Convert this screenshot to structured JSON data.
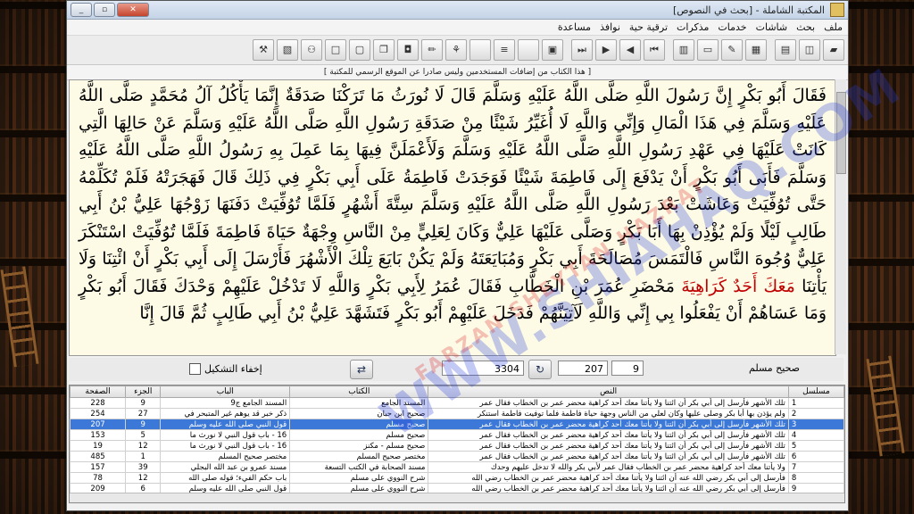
{
  "window": {
    "title": "المكتبة الشاملة - [بحث في النصوص]",
    "controls": [
      "_",
      "▫",
      "✕"
    ]
  },
  "menu": [
    "ملف",
    "بحث",
    "شاشات",
    "خدمات",
    "مذكرات",
    "ترقية حية",
    "نوافذ",
    "مساعدة"
  ],
  "toolbar_icons": [
    "book-icon",
    "open-book-icon",
    "layout-icon",
    "grid-icon",
    "edit-icon",
    "folder-icon",
    "print-icon",
    "first-icon",
    "prev-icon",
    "next-icon",
    "last-icon",
    "library-icon",
    "blank1",
    "blank2",
    "blank3",
    "edit2-icon",
    "pen-icon",
    "note-icon",
    "copy-icon",
    "save-icon",
    "doc-icon",
    "binoculars-icon",
    "calendar-icon",
    "tools-icon"
  ],
  "notice": "[ هذا الكتاب من إضافات المستخدمين وليس صادرا عن الموقع الرسمي للمكتبة ]",
  "text": {
    "before_highlight": "فَقَالَ أَبُو بَكْرٍ إِنَّ رَسُولَ اللَّهِ صَلَّى اللَّهُ عَلَيْهِ وَسَلَّمَ قَالَ لَا نُورَثُ مَا تَرَكْنَا صَدَقَةٌ إِنَّمَا يَأْكُلُ آلُ مُحَمَّدٍ صَلَّى اللَّهُ عَلَيْهِ وَسَلَّمَ فِي هَذَا الْمَالِ وَإِنِّي وَاللَّهِ لَا أُغَيِّرُ شَيْئًا مِنْ صَدَقَةِ رَسُولِ اللَّهِ صَلَّى اللَّهُ عَلَيْهِ وَسَلَّمَ عَنْ حَالِهَا الَّتِي كَانَتْ عَلَيْهَا فِي عَهْدِ رَسُولِ اللَّهِ صَلَّى اللَّهُ عَلَيْهِ وَسَلَّمَ وَلَأَعْمَلَنَّ فِيهَا بِمَا عَمِلَ بِهِ رَسُولُ اللَّهِ صَلَّى اللَّهُ عَلَيْهِ وَسَلَّمَ فَأَبَى أَبُو بَكْرٍ أَنْ يَدْفَعَ إِلَى فَاطِمَةَ شَيْئًا فَوَجَدَتْ فَاطِمَةُ عَلَى أَبِي بَكْرٍ فِي ذَلِكَ قَالَ فَهَجَرَتْهُ فَلَمْ تُكَلِّمْهُ حَتَّى تُوُفِّيَتْ وَعَاشَتْ بَعْدَ رَسُولِ اللَّهِ صَلَّى اللَّهُ عَلَيْهِ وَسَلَّمَ سِتَّةَ أَشْهُرٍ فَلَمَّا تُوُفِّيَتْ دَفَنَهَا زَوْجُهَا عَلِيُّ بْنُ أَبِي طَالِبٍ لَيْلًا وَلَمْ يُؤْذِنْ بِهَا أَبَا بَكْرٍ وَصَلَّى عَلَيْهَا عَلِيٌّ وَكَانَ لِعَلِيٍّ مِنْ النَّاسِ وِجْهَةٌ حَيَاةَ فَاطِمَةَ فَلَمَّا تُوُفِّيَتْ اسْتَنْكَرَ عَلِيٌّ وُجُوهَ النَّاسِ فَالْتَمَسَ مُصَالَحَةَ أَبِي بَكْرٍ وَمُبَايَعَتَهُ وَلَمْ يَكُنْ بَايَعَ تِلْكَ الْأَشْهُرَ فَأَرْسَلَ إِلَى أَبِي بَكْرٍ أَنْ ائْتِنَا وَلَا يَأْتِنَا",
    "highlight": "مَعَكَ أَحَدٌ كَرَاهِيَةَ",
    "after_highlight": "مَحْضَرِ عُمَرَ بْنِ الْخَطَّابِ فَقَالَ عُمَرُ لِأَبِي بَكْرٍ وَاللَّهِ لَا تَدْخُلْ عَلَيْهِمْ وَحْدَكَ فَقَالَ أَبُو بَكْرٍ وَمَا عَسَاهُمْ أَنْ يَفْعَلُوا بِي إِنِّي وَاللَّهِ لَآتِيَنَّهُمْ فَدَخَلَ عَلَيْهِمْ أَبُو بَكْرٍ فَتَشَهَّدَ عَلِيُّ بْنُ أَبِي طَالِبٍ ثُمَّ قَالَ إِنَّا"
  },
  "watermark": {
    "main": "WWW.SHIAHAQ.COM",
    "sub": "FARZAN SHEYTAN HAZRAT"
  },
  "nav": {
    "hide_diacritics_label": "إخفاء التشكيل",
    "field_a": "3304",
    "field_b": "207",
    "field_c": "9",
    "book_label": "صحيح مسلم"
  },
  "table": {
    "headers": [
      "الصفحة",
      "الجزء",
      "الباب",
      "الكتاب",
      "النص",
      "مسلسل"
    ],
    "rows": [
      {
        "page": "228",
        "part": "9",
        "chapter": "المسند الجامع ج9",
        "book": "المسند الجامع",
        "text": "تلك الأشهر فأرسل إلى أبي بكر أن ائتنا ولا يأتنا معك أحد كراهية محضر عمر بن الخطاب فقال عمر",
        "n": "1"
      },
      {
        "page": "254",
        "part": "27",
        "chapter": "ذكر خبر قد يوهم غير المتبحر في",
        "book": "صحيح ابن حبان",
        "text": "ولم يؤذن بها أبا بكر وصلى عليها وكان لعلي من الناس وجهة حياة فاطمة فلما توفيت فاطمة استنكر",
        "n": "2"
      },
      {
        "page": "207",
        "part": "9",
        "chapter": "قول النبي صلى الله عليه وسلم",
        "book": "صحيح مسلم",
        "text": "تلك الأشهر فأرسل إلى أبي بكر أن ائتنا ولا يأتنا معك أحد كراهية محضر عمر بن الخطاب فقال عمر",
        "n": "3",
        "selected": true
      },
      {
        "page": "153",
        "part": "5",
        "chapter": "16 - باب قول النبي لا نورث ما",
        "book": "صحيح مسلم",
        "text": "تلك الأشهر فأرسل إلى أبي بكر أن ائتنا ولا يأتنا معك أحد كراهية محضر عمر بن الخطاب فقال عمر",
        "n": "4"
      },
      {
        "page": "19",
        "part": "12",
        "chapter": "16 - باب قول النبي لا نورث ما",
        "book": "صحيح مسلم - مكنز",
        "text": "تلك الأشهر فأرسل إلى أبي بكر أن ائتنا ولا يأتنا معك أحد كراهية محضر عمر بن الخطاب فقال عمر",
        "n": "5"
      },
      {
        "page": "485",
        "part": "1",
        "chapter": "مختصر صحيح المسلم",
        "book": "مختصر صحيح المسلم",
        "text": "تلك الأشهر فأرسل إلى أبي بكر أن ائتنا ولا يأتنا معك أحد كراهية محضر عمر بن الخطاب فقال عمر",
        "n": "6"
      },
      {
        "page": "157",
        "part": "39",
        "chapter": "مسند عمرو بن عبد الله البجلي",
        "book": "مسند الصحابة في الكتب التسعة",
        "text": "ولا يأتنا معك أحد كراهية محضر عمر بن الخطاب فقال عمر لأبي بكر والله لا تدخل عليهم وحدك",
        "n": "7"
      },
      {
        "page": "78",
        "part": "12",
        "chapter": "باب حكم الفيء؛ قوله صلى الله",
        "book": "شرح النووي على مسلم",
        "text": "فأرسل إلى أبي بكر رضي الله عنه أن ائتنا ولا يأتنا معك أحد كراهية محضر عمر بن الخطاب رضي الله",
        "n": "8"
      },
      {
        "page": "209",
        "part": "6",
        "chapter": "قول النبي صلى الله عليه وسلم",
        "book": "شرح النووي على مسلم",
        "text": "فأرسل إلى أبي بكر رضي الله عنه أن ائتنا ولا يأتنا معك أحد كراهية محضر عمر بن الخطاب رضي الله",
        "n": "9"
      }
    ]
  }
}
